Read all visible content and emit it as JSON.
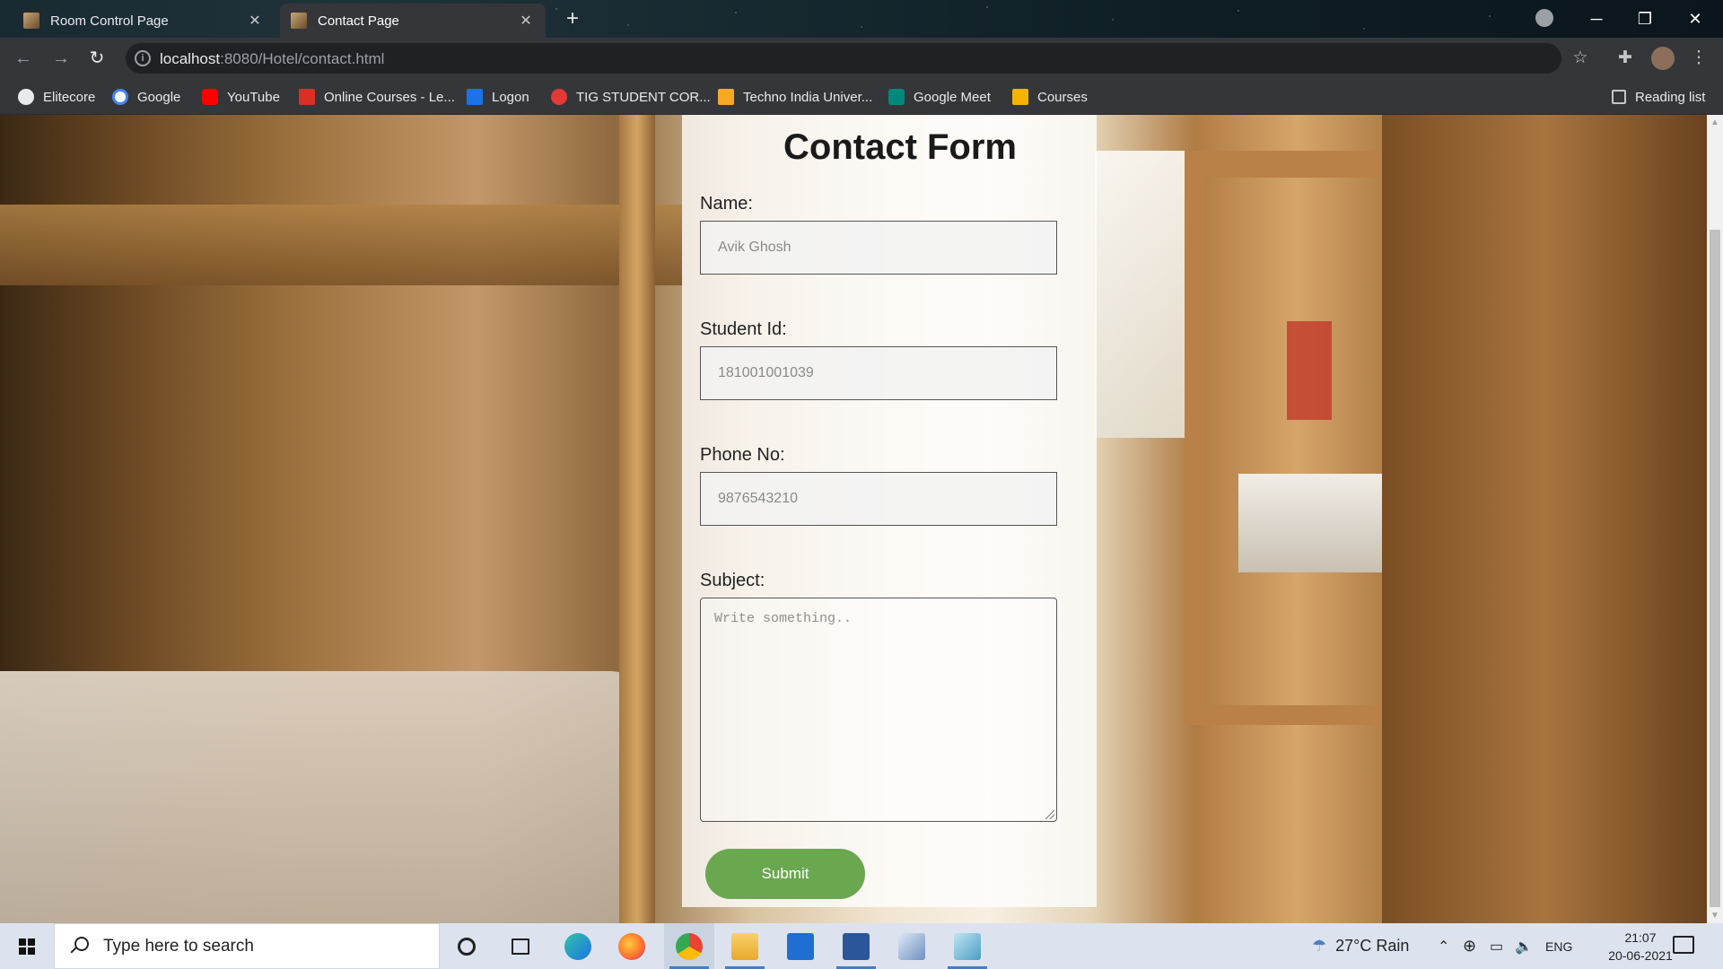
{
  "browser": {
    "tabs": [
      {
        "title": "Room Control Page",
        "active": false
      },
      {
        "title": "Contact Page",
        "active": true
      }
    ],
    "new_tab": "+",
    "url_host": "localhost",
    "url_path": ":8080/Hotel/contact.html",
    "bookmarks": [
      {
        "label": "Elitecore",
        "color": "#e8eaed"
      },
      {
        "label": "Google",
        "color": "#4285f4"
      },
      {
        "label": "YouTube",
        "color": "#ff0000"
      },
      {
        "label": "Online Courses - Le...",
        "color": "#d93025"
      },
      {
        "label": "Logon",
        "color": "#1a73e8"
      },
      {
        "label": "TIG STUDENT COR...",
        "color": "#e53935"
      },
      {
        "label": "Techno India Univer...",
        "color": "#f9a825"
      },
      {
        "label": "Google Meet",
        "color": "#00897b"
      },
      {
        "label": "Courses",
        "color": "#f4b400"
      }
    ],
    "reading_list": "Reading list"
  },
  "form": {
    "title": "Contact Form",
    "name_label": "Name:",
    "name_value": "Avik Ghosh",
    "student_id_label": "Student Id:",
    "student_id_value": "181001001039",
    "phone_label": "Phone No:",
    "phone_value": "9876543210",
    "subject_label": "Subject:",
    "subject_placeholder": "Write something..",
    "submit_label": "Submit",
    "submit_color": "#6aa84f"
  },
  "taskbar": {
    "search_placeholder": "Type here to search",
    "weather": "27°C  Rain",
    "language": "ENG",
    "time": "21:07",
    "date": "20-06-2021",
    "apps": [
      "cortana-icon",
      "task-view-icon",
      "edge-icon",
      "firefox-icon",
      "chrome-icon",
      "file-explorer-icon",
      "mail-icon",
      "word-icon",
      "3d-viewer-icon",
      "app-icon"
    ]
  }
}
